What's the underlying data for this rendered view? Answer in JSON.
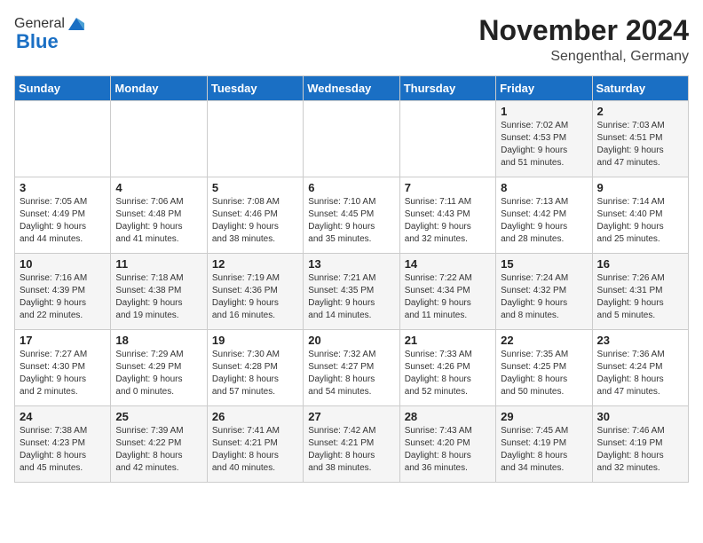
{
  "header": {
    "logo_general": "General",
    "logo_blue": "Blue",
    "month_title": "November 2024",
    "location": "Sengenthal, Germany"
  },
  "weekdays": [
    "Sunday",
    "Monday",
    "Tuesday",
    "Wednesday",
    "Thursday",
    "Friday",
    "Saturday"
  ],
  "weeks": [
    [
      {
        "day": "",
        "info": ""
      },
      {
        "day": "",
        "info": ""
      },
      {
        "day": "",
        "info": ""
      },
      {
        "day": "",
        "info": ""
      },
      {
        "day": "",
        "info": ""
      },
      {
        "day": "1",
        "info": "Sunrise: 7:02 AM\nSunset: 4:53 PM\nDaylight: 9 hours\nand 51 minutes."
      },
      {
        "day": "2",
        "info": "Sunrise: 7:03 AM\nSunset: 4:51 PM\nDaylight: 9 hours\nand 47 minutes."
      }
    ],
    [
      {
        "day": "3",
        "info": "Sunrise: 7:05 AM\nSunset: 4:49 PM\nDaylight: 9 hours\nand 44 minutes."
      },
      {
        "day": "4",
        "info": "Sunrise: 7:06 AM\nSunset: 4:48 PM\nDaylight: 9 hours\nand 41 minutes."
      },
      {
        "day": "5",
        "info": "Sunrise: 7:08 AM\nSunset: 4:46 PM\nDaylight: 9 hours\nand 38 minutes."
      },
      {
        "day": "6",
        "info": "Sunrise: 7:10 AM\nSunset: 4:45 PM\nDaylight: 9 hours\nand 35 minutes."
      },
      {
        "day": "7",
        "info": "Sunrise: 7:11 AM\nSunset: 4:43 PM\nDaylight: 9 hours\nand 32 minutes."
      },
      {
        "day": "8",
        "info": "Sunrise: 7:13 AM\nSunset: 4:42 PM\nDaylight: 9 hours\nand 28 minutes."
      },
      {
        "day": "9",
        "info": "Sunrise: 7:14 AM\nSunset: 4:40 PM\nDaylight: 9 hours\nand 25 minutes."
      }
    ],
    [
      {
        "day": "10",
        "info": "Sunrise: 7:16 AM\nSunset: 4:39 PM\nDaylight: 9 hours\nand 22 minutes."
      },
      {
        "day": "11",
        "info": "Sunrise: 7:18 AM\nSunset: 4:38 PM\nDaylight: 9 hours\nand 19 minutes."
      },
      {
        "day": "12",
        "info": "Sunrise: 7:19 AM\nSunset: 4:36 PM\nDaylight: 9 hours\nand 16 minutes."
      },
      {
        "day": "13",
        "info": "Sunrise: 7:21 AM\nSunset: 4:35 PM\nDaylight: 9 hours\nand 14 minutes."
      },
      {
        "day": "14",
        "info": "Sunrise: 7:22 AM\nSunset: 4:34 PM\nDaylight: 9 hours\nand 11 minutes."
      },
      {
        "day": "15",
        "info": "Sunrise: 7:24 AM\nSunset: 4:32 PM\nDaylight: 9 hours\nand 8 minutes."
      },
      {
        "day": "16",
        "info": "Sunrise: 7:26 AM\nSunset: 4:31 PM\nDaylight: 9 hours\nand 5 minutes."
      }
    ],
    [
      {
        "day": "17",
        "info": "Sunrise: 7:27 AM\nSunset: 4:30 PM\nDaylight: 9 hours\nand 2 minutes."
      },
      {
        "day": "18",
        "info": "Sunrise: 7:29 AM\nSunset: 4:29 PM\nDaylight: 9 hours\nand 0 minutes."
      },
      {
        "day": "19",
        "info": "Sunrise: 7:30 AM\nSunset: 4:28 PM\nDaylight: 8 hours\nand 57 minutes."
      },
      {
        "day": "20",
        "info": "Sunrise: 7:32 AM\nSunset: 4:27 PM\nDaylight: 8 hours\nand 54 minutes."
      },
      {
        "day": "21",
        "info": "Sunrise: 7:33 AM\nSunset: 4:26 PM\nDaylight: 8 hours\nand 52 minutes."
      },
      {
        "day": "22",
        "info": "Sunrise: 7:35 AM\nSunset: 4:25 PM\nDaylight: 8 hours\nand 50 minutes."
      },
      {
        "day": "23",
        "info": "Sunrise: 7:36 AM\nSunset: 4:24 PM\nDaylight: 8 hours\nand 47 minutes."
      }
    ],
    [
      {
        "day": "24",
        "info": "Sunrise: 7:38 AM\nSunset: 4:23 PM\nDaylight: 8 hours\nand 45 minutes."
      },
      {
        "day": "25",
        "info": "Sunrise: 7:39 AM\nSunset: 4:22 PM\nDaylight: 8 hours\nand 42 minutes."
      },
      {
        "day": "26",
        "info": "Sunrise: 7:41 AM\nSunset: 4:21 PM\nDaylight: 8 hours\nand 40 minutes."
      },
      {
        "day": "27",
        "info": "Sunrise: 7:42 AM\nSunset: 4:21 PM\nDaylight: 8 hours\nand 38 minutes."
      },
      {
        "day": "28",
        "info": "Sunrise: 7:43 AM\nSunset: 4:20 PM\nDaylight: 8 hours\nand 36 minutes."
      },
      {
        "day": "29",
        "info": "Sunrise: 7:45 AM\nSunset: 4:19 PM\nDaylight: 8 hours\nand 34 minutes."
      },
      {
        "day": "30",
        "info": "Sunrise: 7:46 AM\nSunset: 4:19 PM\nDaylight: 8 hours\nand 32 minutes."
      }
    ]
  ]
}
